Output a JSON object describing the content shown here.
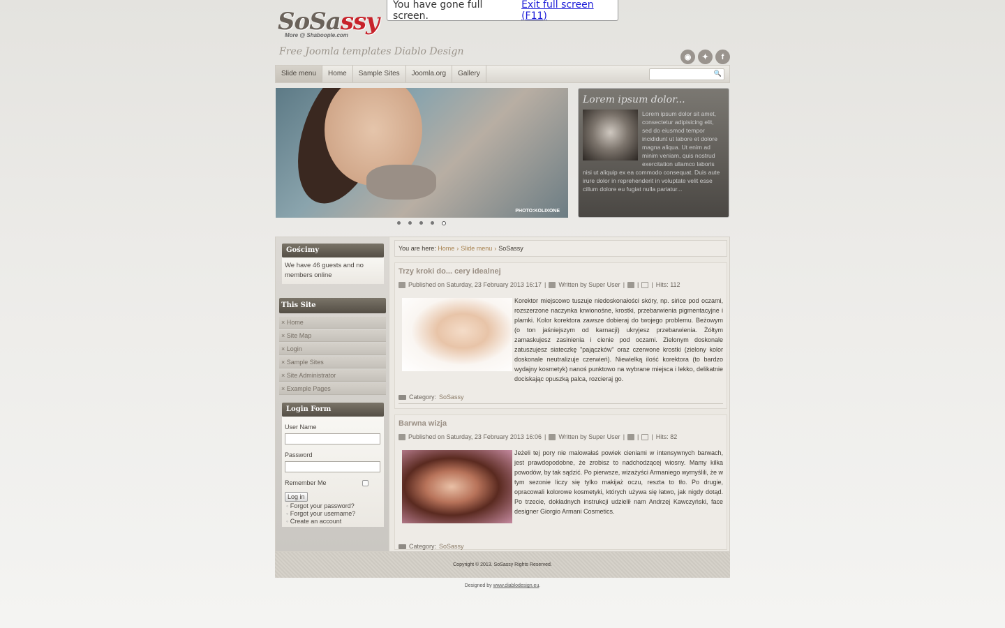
{
  "fullscreen_notice": {
    "message": "You have gone full screen.",
    "exit_link": "Exit full screen (F11)"
  },
  "header": {
    "logo_text_a": "So",
    "logo_text_b": "Sa",
    "logo_text_c": "ssy",
    "logo_sub": "More @ Shaboople.com",
    "tagline": "Free Joomla templates Diablo Design",
    "social_icons": [
      "rss-icon",
      "twitter-icon",
      "facebook-icon"
    ]
  },
  "nav": {
    "items": [
      "Slide menu",
      "Home",
      "Sample Sites",
      "Joomla.org",
      "Gallery"
    ],
    "search_placeholder": ""
  },
  "slider": {
    "credit": "PHOTO:KOLIXONE",
    "dots": 5,
    "active_dot": 5
  },
  "lorem": {
    "title": "Lorem ipsum dolor...",
    "text": "Lorem ipsum dolor sit amet, consectetur adipisicing elit, sed do eiusmod tempor incididunt ut labore et dolore magna aliqua. Ut enim ad minim veniam, quis nostrud exercitation ullamco laboris nisi ut aliquip ex ea commodo consequat. Duis aute irure dolor in reprehenderit in voluptate velit esse cillum dolore eu fugiat nulla pariatur..."
  },
  "sidebar": {
    "guests": {
      "title": "Gościmy",
      "text": "We have 46 guests and no members online"
    },
    "this_site": {
      "title": "This Site",
      "items": [
        "× Home",
        "× Site Map",
        "× Login",
        "× Sample Sites",
        "× Site Administrator",
        "× Example Pages"
      ]
    },
    "login": {
      "title": "Login Form",
      "username_label": "User Name",
      "password_label": "Password",
      "remember_label": "Remember Me",
      "button": "Log in",
      "links": [
        "Forgot your password?",
        "Forgot your username?",
        "Create an account"
      ]
    }
  },
  "breadcrumb": {
    "prefix": "You are here:",
    "home": "Home",
    "slide": "Slide menu",
    "current": "SoSassy"
  },
  "articles": [
    {
      "title": "Trzy kroki do... cery idealnej",
      "published": "Published on Saturday, 23 February 2013 16:17",
      "author": "Written by Super User",
      "hits": "Hits: 112",
      "text": "Korektor miejscowo tuszuje niedoskonałości skóry, np. sińce pod oczami, rozszerzone naczynka krwionośne, krostki, przebarwienia pigmentacyjne i plamki. Kolor korektora zawsze dobieraj do twojego problemu. Beżowym (o ton jaśniejszym od karnacji) ukryjesz przebarwienia. Żółtym zamaskujesz zasinienia i cienie pod oczami. Zielonym doskonale zatuszujesz siateczkę \"pajączków\" oraz czerwone krostki (zielony kolor doskonale neutralizuje czerwień). Niewielką ilość korektora (to bardzo wydajny kosmetyk) nanoś punktowo na wybrane miejsca i lekko, delikatnie dociskając opuszką palca, rozcieraj go.",
      "category_label": "Category:",
      "category": "SoSassy"
    },
    {
      "title": "Barwna wizja",
      "published": "Published on Saturday, 23 February 2013 16:06",
      "author": "Written by Super User",
      "hits": "Hits: 82",
      "text": "Jeżeli tej pory nie malowałaś powiek cieniami w intensywnych barwach, jest prawdopodobne, że zrobisz to nadchodzącej wiosny. Mamy kilka powodów, by tak sądzić. Po pierwsze, wizażyści Armaniego wymyślili, że w tym sezonie liczy się tylko makijaż oczu, reszta to tło. Po drugie, opracowali kolorowe kosmetyki, których używa się łatwo, jak nigdy dotąd. Po trzecie, dokładnych instrukcji udzielił nam Andrzej Kawczyński, face designer Giorgio Armani Cosmetics.",
      "category_label": "Category:",
      "category": "SoSassy"
    }
  ],
  "footer": {
    "copyright": "Copyright © 2013. SoSassy  Rights Reserved.",
    "designed_prefix": "Designed by",
    "designed_link": "www.diablodesign.eu",
    "designed_suffix": "."
  }
}
